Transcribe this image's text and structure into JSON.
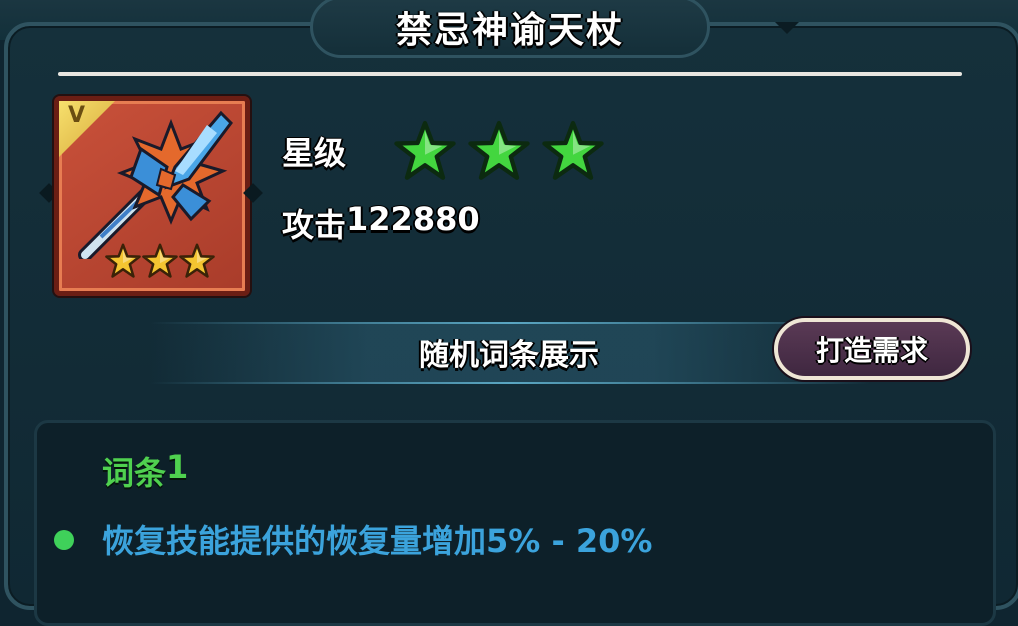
{
  "dialog": {
    "title": "禁忌神谕天杖"
  },
  "item": {
    "badge": "V",
    "icon_stars": 3,
    "weapon_icon": "staff-icon"
  },
  "stats": {
    "star_label": "星级",
    "star_count": 3,
    "attack_label": "攻击",
    "attack_value": "122880"
  },
  "affix_section": {
    "title": "随机词条展示",
    "craft_button": "打造需求"
  },
  "affixes": [
    {
      "label": "词条",
      "index": "1",
      "description": "恢复技能提供的恢复量增加5% - 20%"
    }
  ],
  "colors": {
    "panel_bg": "#102833",
    "border": "#2f5360",
    "item_bg": "#c9513a",
    "grade_star": "#43d63f",
    "icon_star": "#f4c531",
    "affix_title": "#4fd14f",
    "affix_text": "#3ba3dc",
    "button_bg": "#4a3048"
  }
}
